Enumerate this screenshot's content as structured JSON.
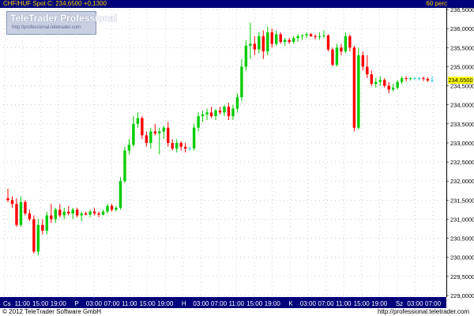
{
  "header": {
    "title": "CHF/HUF Spot C: 234,6500 +0,1300",
    "interval": "60 perc"
  },
  "logo": {
    "name": "TeleTrader Professional",
    "url": "http://professional.teletrader.com"
  },
  "footer": {
    "copyright": "© 2012 TeleTrader Software GmbH",
    "url": "http://professional.teletrader.com"
  },
  "last_price_label": "234,6500",
  "colors": {
    "up": "#00cc00",
    "down": "#ff0000",
    "doji": "#33cccc",
    "header_bg": "#00007a",
    "header_text": "#ffd400",
    "grid": "#b0b0b0",
    "badge": "#ffff00"
  },
  "chart_data": {
    "type": "candlestick",
    "title": "CHF/HUF Spot",
    "grid": true,
    "y_axis": {
      "position": "right",
      "range": [
        229.0,
        236.5
      ],
      "ticks": [
        236.5,
        236.0,
        235.5,
        235.0,
        234.5,
        234.0,
        233.5,
        233.0,
        232.5,
        232.0,
        231.5,
        231.0,
        230.5,
        230.0,
        229.5,
        229.0
      ],
      "tick_labels": [
        "236,5000",
        "236,0000",
        "235,5000",
        "235,0000",
        "234,5000",
        "234,0000",
        "233,5000",
        "233,0000",
        "232,5000",
        "232,0000",
        "231,5000",
        "231,0000",
        "230,5000",
        "230,0000",
        "229,5000",
        "229,0000"
      ]
    },
    "x_axis": {
      "tick_labels": [
        "Cs",
        "11:00",
        "15:00",
        "19:00",
        "P",
        "03:00",
        "07:00",
        "11:00",
        "15:00",
        "19:00",
        "H",
        "03:00",
        "07:00",
        "11:00",
        "15:00",
        "19:00",
        "K",
        "03:00",
        "07:00",
        "11:00",
        "15:00",
        "19:00",
        "Sz",
        "03:00",
        "07:00"
      ]
    },
    "last_price": 234.65,
    "candles": [
      {
        "o": 231.55,
        "h": 231.8,
        "l": 231.45,
        "c": 231.5
      },
      {
        "o": 231.5,
        "h": 231.6,
        "l": 231.3,
        "c": 231.4
      },
      {
        "o": 231.4,
        "h": 231.55,
        "l": 230.8,
        "c": 230.85
      },
      {
        "o": 230.85,
        "h": 231.6,
        "l": 230.8,
        "c": 231.45
      },
      {
        "o": 231.45,
        "h": 231.5,
        "l": 231.1,
        "c": 231.15
      },
      {
        "o": 231.15,
        "h": 231.25,
        "l": 230.95,
        "c": 231.0
      },
      {
        "o": 231.0,
        "h": 231.1,
        "l": 230.1,
        "c": 230.15
      },
      {
        "o": 230.15,
        "h": 231.0,
        "l": 230.05,
        "c": 230.85
      },
      {
        "o": 230.85,
        "h": 231.0,
        "l": 230.6,
        "c": 230.7
      },
      {
        "o": 230.7,
        "h": 231.2,
        "l": 230.6,
        "c": 231.1
      },
      {
        "o": 231.1,
        "h": 231.4,
        "l": 230.9,
        "c": 231.0
      },
      {
        "o": 231.0,
        "h": 231.3,
        "l": 230.9,
        "c": 231.25
      },
      {
        "o": 231.25,
        "h": 231.4,
        "l": 231.05,
        "c": 231.1
      },
      {
        "o": 231.1,
        "h": 231.3,
        "l": 231.0,
        "c": 231.2
      },
      {
        "o": 231.2,
        "h": 231.35,
        "l": 231.1,
        "c": 231.15
      },
      {
        "o": 231.15,
        "h": 231.3,
        "l": 231.0,
        "c": 231.25
      },
      {
        "o": 231.25,
        "h": 231.3,
        "l": 231.05,
        "c": 231.1
      },
      {
        "o": 231.1,
        "h": 231.2,
        "l": 230.95,
        "c": 231.15
      },
      {
        "o": 231.15,
        "h": 231.2,
        "l": 231.1,
        "c": 231.12
      },
      {
        "o": 231.12,
        "h": 231.25,
        "l": 231.05,
        "c": 231.2
      },
      {
        "o": 231.2,
        "h": 231.3,
        "l": 231.1,
        "c": 231.15
      },
      {
        "o": 231.15,
        "h": 231.2,
        "l": 231.05,
        "c": 231.12
      },
      {
        "o": 231.12,
        "h": 231.25,
        "l": 231.1,
        "c": 231.2
      },
      {
        "o": 231.2,
        "h": 231.4,
        "l": 231.15,
        "c": 231.35
      },
      {
        "o": 231.35,
        "h": 231.4,
        "l": 231.2,
        "c": 231.25
      },
      {
        "o": 231.25,
        "h": 231.35,
        "l": 231.2,
        "c": 231.3
      },
      {
        "o": 231.3,
        "h": 232.1,
        "l": 231.25,
        "c": 232.0
      },
      {
        "o": 232.0,
        "h": 232.9,
        "l": 231.95,
        "c": 232.8
      },
      {
        "o": 232.8,
        "h": 233.1,
        "l": 232.7,
        "c": 232.95
      },
      {
        "o": 232.95,
        "h": 233.7,
        "l": 232.9,
        "c": 233.5
      },
      {
        "o": 233.5,
        "h": 233.8,
        "l": 233.4,
        "c": 233.65
      },
      {
        "o": 233.65,
        "h": 233.7,
        "l": 233.1,
        "c": 233.2
      },
      {
        "o": 233.2,
        "h": 233.3,
        "l": 232.9,
        "c": 233.0
      },
      {
        "o": 233.0,
        "h": 233.4,
        "l": 232.85,
        "c": 233.3
      },
      {
        "o": 233.3,
        "h": 233.5,
        "l": 233.2,
        "c": 233.25
      },
      {
        "o": 233.25,
        "h": 233.4,
        "l": 232.7,
        "c": 233.3
      },
      {
        "o": 233.3,
        "h": 233.45,
        "l": 233.1,
        "c": 233.4
      },
      {
        "o": 233.4,
        "h": 233.55,
        "l": 232.9,
        "c": 233.0
      },
      {
        "o": 233.0,
        "h": 233.1,
        "l": 232.8,
        "c": 232.85
      },
      {
        "o": 232.85,
        "h": 233.1,
        "l": 232.75,
        "c": 233.0
      },
      {
        "o": 233.0,
        "h": 233.05,
        "l": 232.8,
        "c": 232.9
      },
      {
        "o": 232.9,
        "h": 233.0,
        "l": 232.75,
        "c": 232.85
      },
      {
        "o": 232.85,
        "h": 232.9,
        "l": 232.8,
        "c": 232.86
      },
      {
        "o": 232.86,
        "h": 233.5,
        "l": 232.8,
        "c": 233.4
      },
      {
        "o": 233.4,
        "h": 233.8,
        "l": 233.3,
        "c": 233.7
      },
      {
        "o": 233.7,
        "h": 233.85,
        "l": 233.55,
        "c": 233.75
      },
      {
        "o": 233.75,
        "h": 233.9,
        "l": 233.6,
        "c": 233.8
      },
      {
        "o": 233.8,
        "h": 233.95,
        "l": 233.65,
        "c": 233.7
      },
      {
        "o": 233.7,
        "h": 233.9,
        "l": 233.6,
        "c": 233.85
      },
      {
        "o": 233.85,
        "h": 233.95,
        "l": 233.75,
        "c": 233.8
      },
      {
        "o": 233.8,
        "h": 234.0,
        "l": 233.7,
        "c": 233.95
      },
      {
        "o": 233.95,
        "h": 234.05,
        "l": 233.6,
        "c": 233.7
      },
      {
        "o": 233.7,
        "h": 234.0,
        "l": 233.6,
        "c": 233.9
      },
      {
        "o": 233.9,
        "h": 234.3,
        "l": 233.8,
        "c": 234.2
      },
      {
        "o": 234.2,
        "h": 235.2,
        "l": 234.1,
        "c": 235.0
      },
      {
        "o": 235.0,
        "h": 235.7,
        "l": 234.9,
        "c": 235.55
      },
      {
        "o": 235.55,
        "h": 236.15,
        "l": 235.2,
        "c": 235.6
      },
      {
        "o": 235.6,
        "h": 235.8,
        "l": 235.3,
        "c": 235.45
      },
      {
        "o": 235.45,
        "h": 235.9,
        "l": 235.35,
        "c": 235.8
      },
      {
        "o": 235.8,
        "h": 235.95,
        "l": 235.2,
        "c": 235.4
      },
      {
        "o": 235.4,
        "h": 236.05,
        "l": 235.3,
        "c": 235.9
      },
      {
        "o": 235.9,
        "h": 236.0,
        "l": 235.5,
        "c": 235.6
      },
      {
        "o": 235.6,
        "h": 235.95,
        "l": 235.55,
        "c": 235.85
      },
      {
        "o": 235.85,
        "h": 235.9,
        "l": 235.6,
        "c": 235.65
      },
      {
        "o": 235.65,
        "h": 235.75,
        "l": 235.55,
        "c": 235.7
      },
      {
        "o": 235.7,
        "h": 235.75,
        "l": 235.6,
        "c": 235.65
      },
      {
        "o": 235.65,
        "h": 235.8,
        "l": 235.6,
        "c": 235.75
      },
      {
        "o": 235.75,
        "h": 235.85,
        "l": 235.65,
        "c": 235.8
      },
      {
        "o": 235.8,
        "h": 235.85,
        "l": 235.7,
        "c": 235.82
      },
      {
        "o": 235.82,
        "h": 235.9,
        "l": 235.75,
        "c": 235.85
      },
      {
        "o": 235.85,
        "h": 235.88,
        "l": 235.78,
        "c": 235.8
      },
      {
        "o": 235.8,
        "h": 235.85,
        "l": 235.72,
        "c": 235.78
      },
      {
        "o": 235.78,
        "h": 235.9,
        "l": 235.7,
        "c": 235.8
      },
      {
        "o": 235.8,
        "h": 235.95,
        "l": 235.75,
        "c": 235.82
      },
      {
        "o": 235.82,
        "h": 235.85,
        "l": 235.4,
        "c": 235.45
      },
      {
        "o": 235.45,
        "h": 235.5,
        "l": 235.0,
        "c": 235.05
      },
      {
        "o": 235.05,
        "h": 235.6,
        "l": 235.0,
        "c": 235.5
      },
      {
        "o": 235.5,
        "h": 235.6,
        "l": 235.3,
        "c": 235.4
      },
      {
        "o": 235.4,
        "h": 235.9,
        "l": 235.35,
        "c": 235.8
      },
      {
        "o": 235.8,
        "h": 235.85,
        "l": 235.4,
        "c": 235.5
      },
      {
        "o": 235.5,
        "h": 235.55,
        "l": 233.3,
        "c": 233.4
      },
      {
        "o": 233.4,
        "h": 235.5,
        "l": 233.35,
        "c": 235.3
      },
      {
        "o": 235.3,
        "h": 235.4,
        "l": 234.9,
        "c": 235.0
      },
      {
        "o": 235.0,
        "h": 235.3,
        "l": 234.7,
        "c": 234.8
      },
      {
        "o": 234.8,
        "h": 234.9,
        "l": 234.5,
        "c": 234.55
      },
      {
        "o": 234.55,
        "h": 234.7,
        "l": 234.45,
        "c": 234.6
      },
      {
        "o": 234.6,
        "h": 234.75,
        "l": 234.5,
        "c": 234.65
      },
      {
        "o": 234.65,
        "h": 234.7,
        "l": 234.45,
        "c": 234.5
      },
      {
        "o": 234.5,
        "h": 234.6,
        "l": 234.3,
        "c": 234.4
      },
      {
        "o": 234.4,
        "h": 234.55,
        "l": 234.35,
        "c": 234.45
      },
      {
        "o": 234.45,
        "h": 234.65,
        "l": 234.4,
        "c": 234.6
      },
      {
        "o": 234.6,
        "h": 234.75,
        "l": 234.55,
        "c": 234.7
      },
      {
        "o": 234.7,
        "h": 234.75,
        "l": 234.62,
        "c": 234.68
      },
      {
        "o": 234.68,
        "h": 234.72,
        "l": 234.64,
        "c": 234.7
      },
      {
        "o": 234.7,
        "h": 234.72,
        "l": 234.65,
        "c": 234.69
      },
      {
        "o": 234.69,
        "h": 234.73,
        "l": 234.64,
        "c": 234.7
      },
      {
        "o": 234.7,
        "h": 234.74,
        "l": 234.62,
        "c": 234.68
      },
      {
        "o": 234.68,
        "h": 234.72,
        "l": 234.6,
        "c": 234.64
      },
      {
        "o": 234.64,
        "h": 234.75,
        "l": 234.58,
        "c": 234.65
      }
    ]
  }
}
